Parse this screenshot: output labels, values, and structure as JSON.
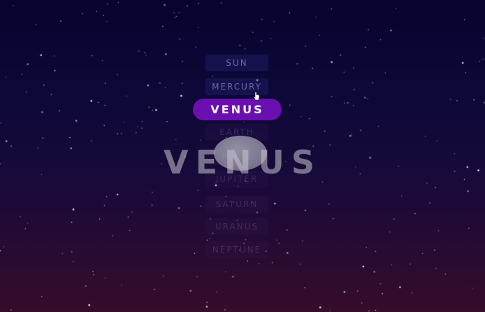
{
  "planets": [
    {
      "label": "SUN",
      "state": "normal"
    },
    {
      "label": "MERCURY",
      "state": "normal"
    },
    {
      "label": "VENUS",
      "state": "active"
    },
    {
      "label": "EARTH",
      "state": "faded"
    },
    {
      "label": "MARS",
      "state": "faded"
    },
    {
      "label": "JUPITER",
      "state": "faded"
    },
    {
      "label": "SATURN",
      "state": "faded"
    },
    {
      "label": "URANUS",
      "state": "faded"
    },
    {
      "label": "NEPTUNE",
      "state": "faded"
    }
  ],
  "selected_title": "VENUS",
  "icons": {
    "cursor": "hand-pointer-icon",
    "planet": "planet-sphere-icon"
  },
  "colors": {
    "active_bg": "#6a0fb0",
    "button_text": "#6a68a8",
    "background_top": "#07052e",
    "background_bottom": "#360d2a"
  }
}
